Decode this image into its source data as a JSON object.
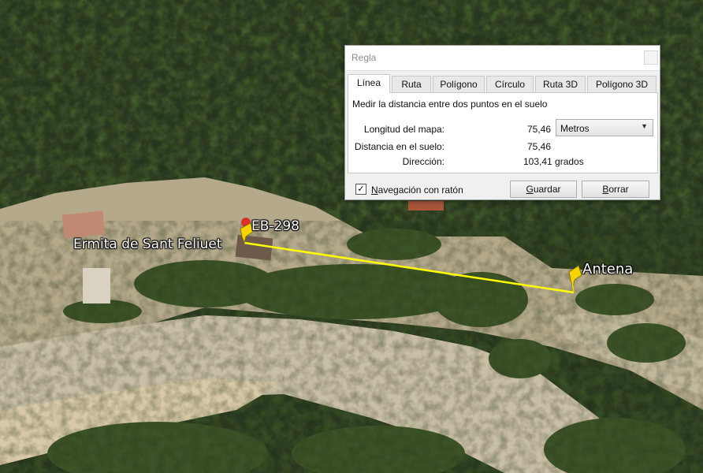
{
  "map": {
    "labels": {
      "ermita": "Ermita de Sant Feliuet",
      "eb": "EB-298",
      "antena": "Antena"
    },
    "ruler_line_color": "#ffff00",
    "pin_color": "#f5d400"
  },
  "dialog": {
    "title": "Regla",
    "tabs": [
      "Línea",
      "Ruta",
      "Polígono",
      "Círculo",
      "Ruta 3D",
      "Polígono 3D"
    ],
    "active_tab": "Línea",
    "description": "Medir la distancia entre dos puntos en el suelo",
    "map_length_label": "Longitud del mapa:",
    "map_length_value": "75,46",
    "unit_selected": "Metros",
    "ground_distance_label": "Distancia en el suelo:",
    "ground_distance_value": "75,46",
    "heading_label": "Dirección:",
    "heading_value": "103,41 grados",
    "mouse_nav_label": "Navegación con ratón",
    "mouse_nav_checked": true,
    "save_label": "Guardar",
    "clear_label": "Borrar"
  }
}
